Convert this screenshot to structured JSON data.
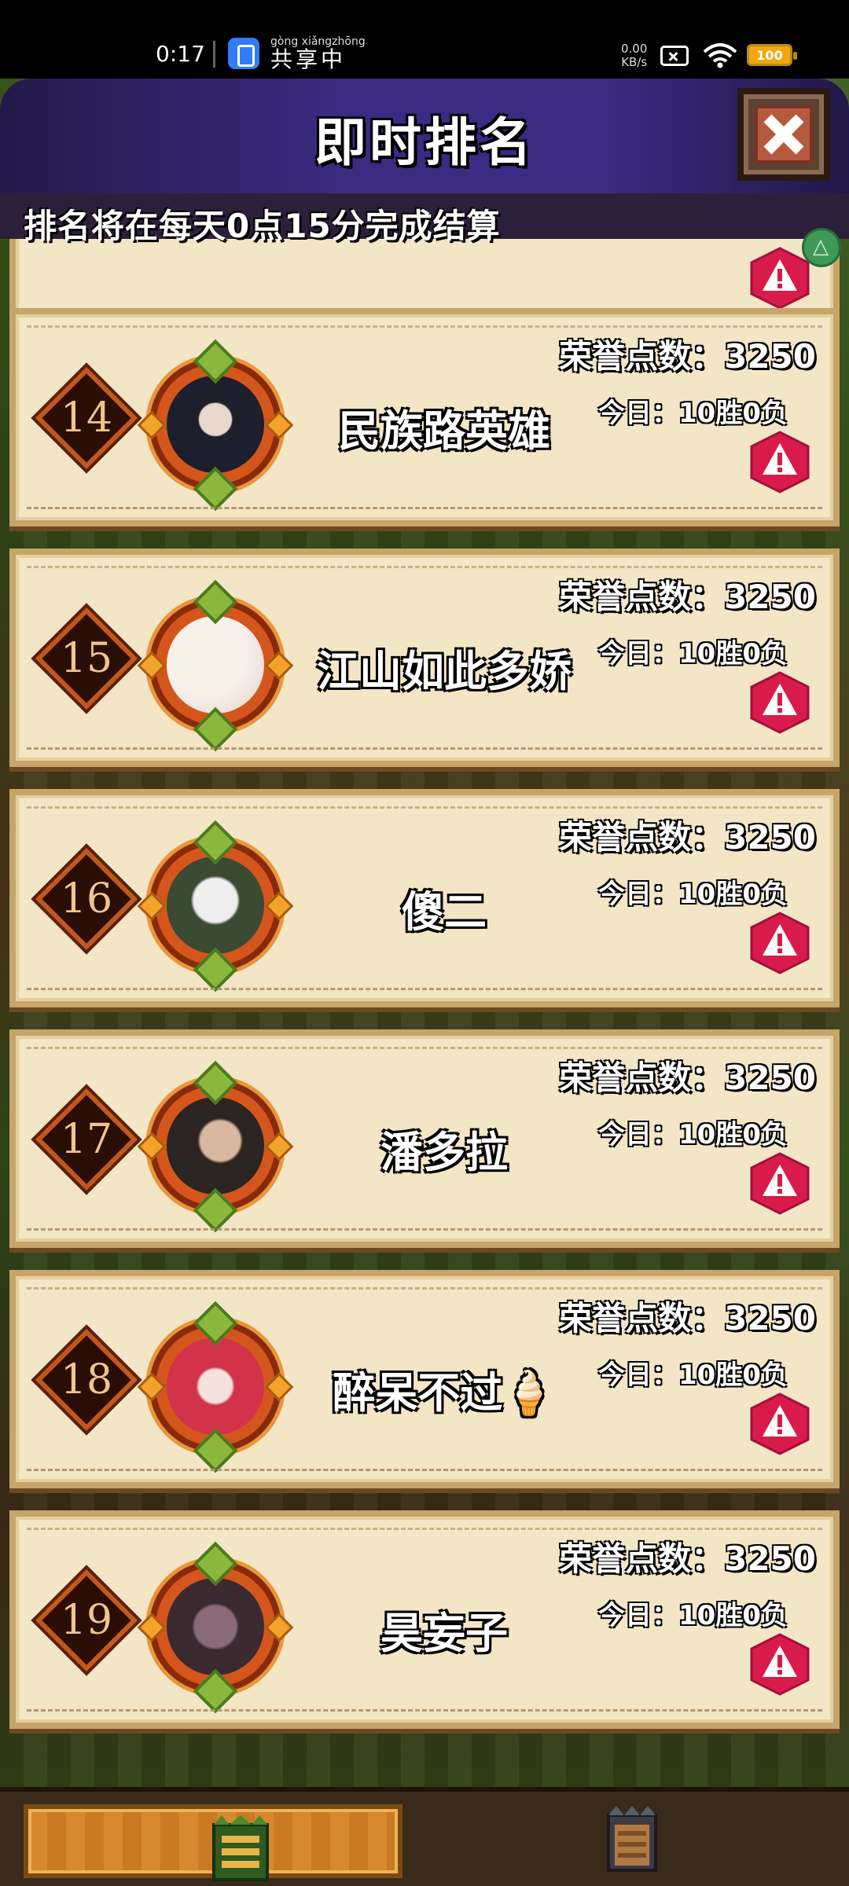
{
  "status_bar": {
    "time": "0:17",
    "share_pinyin": "gòng xiǎngzhōng",
    "share_label": "共享中",
    "net_speed_value": "0.00",
    "net_speed_unit": "KB/s",
    "battery": "100"
  },
  "header": {
    "title": "即时排名",
    "notice": "排名将在每天0点15分完成结算"
  },
  "colors": {
    "header_purple": "#3a2a80",
    "card_bg": "#f3e6c6",
    "rank_ring": "#c2581c",
    "report_red": "#d81b4a"
  },
  "icons": {
    "close": "close-icon",
    "report": "warning-icon",
    "tab_1": "list-icon",
    "tab_2": "scroll-icon"
  },
  "labels": {
    "honor_prefix": "荣誉点数：",
    "record_prefix": "今日："
  },
  "players": [
    {
      "rank": "14",
      "name": "民族路英雄",
      "honor": "荣誉点数：3250",
      "record": "今日：10胜0负"
    },
    {
      "rank": "15",
      "name": "江山如此多娇",
      "honor": "荣誉点数：3250",
      "record": "今日：10胜0负"
    },
    {
      "rank": "16",
      "name": "傻二",
      "honor": "荣誉点数：3250",
      "record": "今日：10胜0负"
    },
    {
      "rank": "17",
      "name": "潘多拉",
      "honor": "荣誉点数：3250",
      "record": "今日：10胜0负"
    },
    {
      "rank": "18",
      "name": "醉呆不过🍦",
      "honor": "荣誉点数：3250",
      "record": "今日：10胜0负"
    },
    {
      "rank": "19",
      "name": "昊妄子",
      "honor": "荣誉点数：3250",
      "record": "今日：10胜0负"
    }
  ]
}
